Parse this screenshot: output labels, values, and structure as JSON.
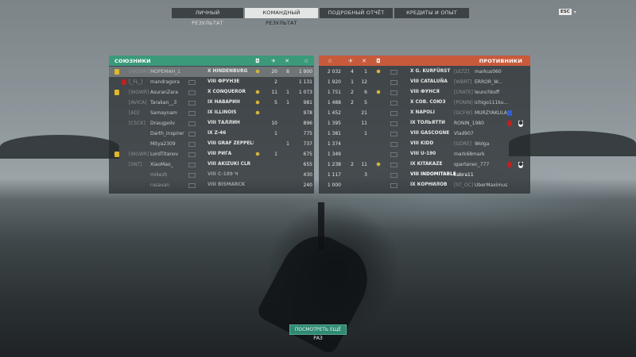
{
  "tabs": [
    {
      "label": "ЛИЧНЫЙ РЕЗУЛЬТАТ",
      "active": false
    },
    {
      "label": "КОМАНДНЫЙ РЕЗУЛЬТАТ",
      "active": true
    },
    {
      "label": "ПОДРОБНЫЙ ОТЧЁТ",
      "active": false
    },
    {
      "label": "КРЕДИТЫ И ОПЫТ",
      "active": false
    }
  ],
  "lang_badge": "ESC",
  "allies": {
    "title": "СОЮЗНИКИ",
    "columns": [
      "planes-icon",
      "ships-icon",
      "swords-icon",
      "star-icon"
    ],
    "players": [
      {
        "clan": "[WGWR]",
        "name": "МОРЕМАН_1",
        "tier": "X",
        "ship": "HINDENBURG",
        "c1": "",
        "c2": "20",
        "c3": "8",
        "c4": "1 900",
        "highlight": true,
        "badge": "y",
        "medal": true
      },
      {
        "clan": "[_FL_]",
        "name": "mandragora",
        "tier": "VIII",
        "ship": "ФРУНЗЕ",
        "c1": "",
        "c2": "2",
        "c3": "",
        "c4": "1 131",
        "highlight": false,
        "badge": "r",
        "medal": false
      },
      {
        "clan": "[WGWR]",
        "name": "AsuranZara",
        "tier": "X",
        "ship": "CONQUEROR",
        "c1": "",
        "c2": "11",
        "c3": "1",
        "c4": "1 073",
        "highlight": false,
        "badge": "y",
        "medal": true
      },
      {
        "clan": "[AVICA]",
        "name": "Tarakan__3",
        "tier": "IX",
        "ship": "НАВАРИН",
        "c1": "",
        "c2": "5",
        "c3": "1",
        "c4": "981",
        "highlight": false,
        "badge": "",
        "medal": true
      },
      {
        "clan": "[AD]",
        "name": "Samaynam",
        "tier": "IX",
        "ship": "ILLINOIS",
        "c1": "",
        "c2": "",
        "c3": "",
        "c4": "978",
        "highlight": false,
        "badge": "",
        "medal": true
      },
      {
        "clan": "[CSCK]",
        "name": "Draugpolv",
        "tier": "VIII",
        "ship": "ТАЛЛИН",
        "c1": "",
        "c2": "10",
        "c3": "",
        "c4": "896",
        "highlight": false,
        "badge": "",
        "medal": false
      },
      {
        "clan": "",
        "name": "Darth_Inspirer",
        "tier": "IX",
        "ship": "Z-46",
        "c1": "",
        "c2": "1",
        "c3": "",
        "c4": "775",
        "highlight": false,
        "badge": "",
        "medal": false
      },
      {
        "clan": "",
        "name": "Mitya2309",
        "tier": "VIII",
        "ship": "GRAF ZEPPELIN B",
        "c1": "",
        "c2": "",
        "c3": "1",
        "c4": "737",
        "highlight": false,
        "badge": "",
        "medal": false
      },
      {
        "clan": "[WGWR]",
        "name": "LordTitanov",
        "tier": "VIII",
        "ship": "РИГА",
        "c1": "",
        "c2": "1",
        "c3": "",
        "c4": "675",
        "highlight": false,
        "badge": "y",
        "medal": true
      },
      {
        "clan": "[SNT]",
        "name": "XiaoMao_",
        "tier": "VIII",
        "ship": "AKIZUKI CLR",
        "c1": "",
        "c2": "",
        "c3": "",
        "c4": "655",
        "highlight": false,
        "badge": "",
        "medal": false
      },
      {
        "clan": "",
        "name": "mikezh",
        "tier": "VIII",
        "ship": "C-189 Ч",
        "c1": "",
        "c2": "",
        "c3": "",
        "c4": "430",
        "highlight": false,
        "badge": "",
        "medal": false,
        "dim": true
      },
      {
        "clan": "",
        "name": "rusavan",
        "tier": "VIII",
        "ship": "BISMARCK",
        "c1": "",
        "c2": "",
        "c3": "",
        "c4": "240",
        "highlight": false,
        "badge": "",
        "medal": false,
        "dim": true
      }
    ]
  },
  "enemies": {
    "title": "ПРОТИВНИКИ",
    "columns": [
      "star-icon",
      "ships-icon",
      "swords-icon",
      "planes-icon"
    ],
    "players": [
      {
        "c1": "2 032",
        "c2": "4",
        "c3": "1",
        "medal": true,
        "tier": "X",
        "ship": "G. KURFÜRST",
        "clan": "[ULTZ]",
        "name": "markus060",
        "badge": "",
        "shield": false
      },
      {
        "c1": "1 920",
        "c2": "1",
        "c3": "12",
        "medal": false,
        "tier": "VIII",
        "ship": "CATALUÑA",
        "clan": "[WBRT]",
        "name": "ERROR_W...",
        "badge": "",
        "shield": false
      },
      {
        "c1": "1 751",
        "c2": "2",
        "c3": "6",
        "medal": true,
        "tier": "VIII",
        "ship": "ФУНСЯ",
        "clan": "[CRATE]",
        "name": "leunchkoff",
        "badge": "",
        "shield": false
      },
      {
        "c1": "1 488",
        "c2": "2",
        "c3": "5",
        "medal": false,
        "tier": "X",
        "ship": "СОВ. СОЮЗ",
        "clan": "[PONIN]",
        "name": "ichigo111ku...",
        "badge": "",
        "shield": false
      },
      {
        "c1": "1 452",
        "c2": "",
        "c3": "21",
        "medal": false,
        "tier": "X",
        "ship": "NAPOLI",
        "clan": "[GCFW]",
        "name": "MURZYAKULA",
        "badge": "b",
        "shield": false
      },
      {
        "c1": "1 395",
        "c2": "",
        "c3": "11",
        "medal": false,
        "tier": "IX",
        "ship": "ТОЛЬЯТТИ",
        "clan": "",
        "name": "RONIN_1980",
        "badge": "r",
        "shield": true
      },
      {
        "c1": "1 381",
        "c2": "",
        "c3": "1",
        "medal": false,
        "tier": "VIII",
        "ship": "GASCOGNE",
        "clan": "",
        "name": "Vlad907",
        "badge": "",
        "shield": false
      },
      {
        "c1": "1 374",
        "c2": "",
        "c3": "",
        "medal": false,
        "tier": "VIII",
        "ship": "KIDD",
        "clan": "[GDRE]",
        "name": "Wolga",
        "badge": "",
        "shield": false
      },
      {
        "c1": "1 349",
        "c2": "",
        "c3": "",
        "medal": false,
        "tier": "VIII",
        "ship": "U-190",
        "clan": "",
        "name": "mark68mark",
        "badge": "",
        "shield": false
      },
      {
        "c1": "1 238",
        "c2": "2",
        "c3": "11",
        "medal": true,
        "tier": "IX",
        "ship": "KITAKAZE",
        "clan": "",
        "name": "spartanec_777",
        "badge": "r",
        "shield": true
      },
      {
        "c1": "1 117",
        "c2": "",
        "c3": "3",
        "medal": false,
        "tier": "VIII",
        "ship": "INDOMITABLE",
        "clan": "",
        "name": "kabra11",
        "badge": "",
        "shield": false,
        "bright": true
      },
      {
        "c1": "1 000",
        "c2": "",
        "c3": "",
        "medal": false,
        "tier": "IX",
        "ship": "КОРНИЛОВ",
        "clan": "[ST_OC]",
        "name": "UberMaximus",
        "badge": "",
        "shield": false
      }
    ]
  },
  "replay_button": "ПОСМОТРЕТЬ ЕЩЁ РАЗ",
  "colors": {
    "allies": "#3a9a7a",
    "enemies": "#c85a3c",
    "accent": "#2e8a72"
  }
}
